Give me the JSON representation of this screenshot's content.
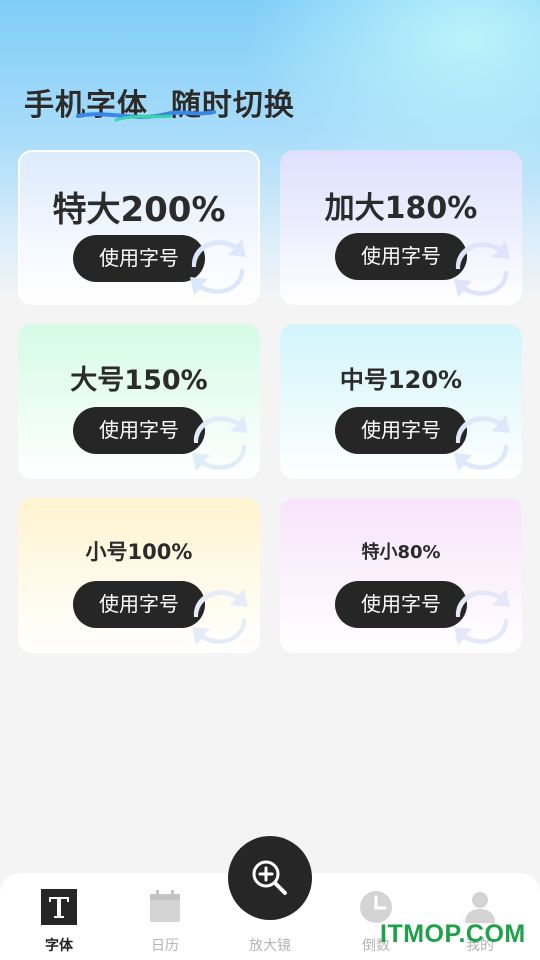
{
  "hero": {
    "title": "手机字体  随时切换"
  },
  "cards": [
    {
      "label": "特大200%",
      "button": "使用字号",
      "bg": "#eef4ff",
      "accent": "#dbe8fb"
    },
    {
      "label": "加大180%",
      "button": "使用字号",
      "bg": "#e6e6ff",
      "accent": "#e2e6fc"
    },
    {
      "label": "大号150%",
      "button": "使用字号",
      "bg": "#ddfbe9",
      "accent": "#e4eef9"
    },
    {
      "label": "中号120%",
      "button": "使用字号",
      "bg": "#dcf7fb",
      "accent": "#e2eefb"
    },
    {
      "label": "小号100%",
      "button": "使用字号",
      "bg": "#fff6d8",
      "accent": "#e8eef9"
    },
    {
      "label": "特小80%",
      "button": "使用字号",
      "bg": "#faeafc",
      "accent": "#e8eaf9"
    }
  ],
  "nav": {
    "items": [
      {
        "label": "字体",
        "icon": "font-t-icon",
        "active": true
      },
      {
        "label": "日历",
        "icon": "calendar-icon",
        "active": false
      },
      {
        "label": "放大镜",
        "icon": "magnifier-plus-icon",
        "active": false
      },
      {
        "label": "倒数",
        "icon": "clock-icon",
        "active": false
      },
      {
        "label": "我的",
        "icon": "user-icon",
        "active": false
      }
    ]
  },
  "watermark": "ITMOP.COM",
  "colors": {
    "button_bg": "#262626",
    "active_nav": "#222222",
    "inactive_nav": "#b4b4b4",
    "watermark": "#1fa14a"
  }
}
